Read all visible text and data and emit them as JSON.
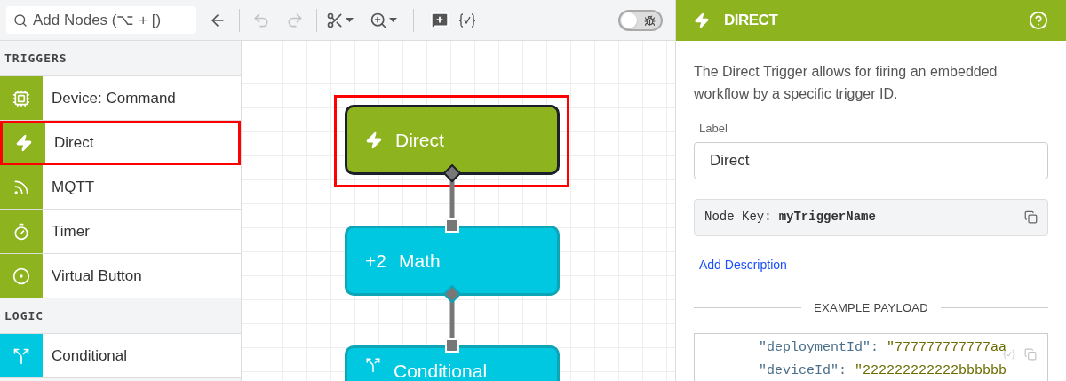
{
  "toolbar": {
    "search": {
      "placeholder": "Add Nodes (⌥ + [)"
    },
    "undo_disabled": true,
    "redo_disabled": true,
    "debug_toggle": {
      "on": false
    }
  },
  "palette": [
    {
      "title": "TRIGGERS",
      "color": "#8db31e",
      "items": [
        {
          "label": "Device: Command",
          "selected": false
        },
        {
          "label": "Direct",
          "selected": true
        },
        {
          "label": "MQTT",
          "selected": false
        },
        {
          "label": "Timer",
          "selected": false
        },
        {
          "label": "Virtual Button",
          "selected": false
        }
      ]
    },
    {
      "title": "LOGIC",
      "color": "#00c8e0",
      "items": [
        {
          "label": "Conditional",
          "selected": false
        }
      ]
    }
  ],
  "canvas": {
    "nodes": [
      {
        "kind": "trigger",
        "label": "Direct",
        "selected": true
      },
      {
        "kind": "logic",
        "icon_text": "+2",
        "label": "Math",
        "selected": false
      },
      {
        "kind": "logic",
        "label": "Conditional",
        "selected": false
      }
    ]
  },
  "panel": {
    "title": "DIRECT",
    "description": "The Direct Trigger allows for firing an embedded workflow by a specific trigger ID.",
    "label_caption": "Label",
    "label_value": "Direct",
    "node_key_caption": "Node Key:",
    "node_key": "myTriggerName",
    "add_description": "Add Description",
    "payload_heading": "EXAMPLE PAYLOAD",
    "payload_lines": [
      {
        "key": "\"deploymentId\"",
        "sep": ":",
        "value": "\"777777777777aa"
      },
      {
        "key": "\"deviceId\"",
        "sep": ":",
        "value": "\"222222222222bbbbbb"
      }
    ]
  }
}
